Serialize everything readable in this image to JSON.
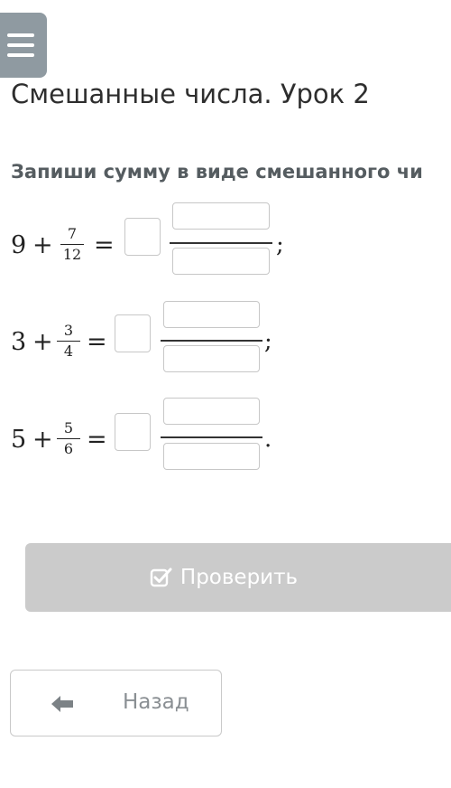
{
  "header": {
    "title": "Смешанные числа. Урок 2"
  },
  "instruction": "Запиши сумму в виде смешанного чи",
  "equations": [
    {
      "whole": "9",
      "operator": "+",
      "numerator": "7",
      "denominator": "12",
      "equals": "=",
      "punctuation": ";"
    },
    {
      "whole": "3",
      "operator": "+",
      "numerator": "3",
      "denominator": "4",
      "equals": "=",
      "punctuation": ";"
    },
    {
      "whole": "5",
      "operator": "+",
      "numerator": "5",
      "denominator": "6",
      "equals": "=",
      "punctuation": "."
    }
  ],
  "buttons": {
    "check_label": "Проверить",
    "check_icon": "check-square-icon",
    "back_label": "Назад",
    "back_icon": "arrow-left-icon"
  },
  "colors": {
    "menu_bg": "#8f9aa1",
    "check_bg": "#cbcbcb",
    "back_border": "#c9c9c9"
  }
}
